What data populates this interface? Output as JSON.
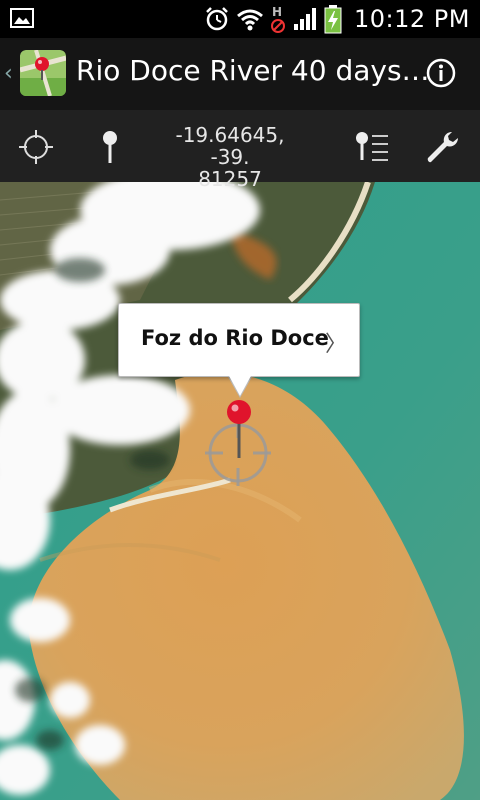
{
  "status_bar": {
    "time": "10:12 PM",
    "battery_color": "#7ac142"
  },
  "action_bar": {
    "title": "Rio Doce River 40 days…"
  },
  "toolbar": {
    "coordinates": "-19.64645, -39.\n81257"
  },
  "map": {
    "marker_label": "Foz do Rio Doce",
    "marker_color": "#e0142c",
    "sediment_color": "#d8a050",
    "ocean_color": "#3aa08c"
  }
}
